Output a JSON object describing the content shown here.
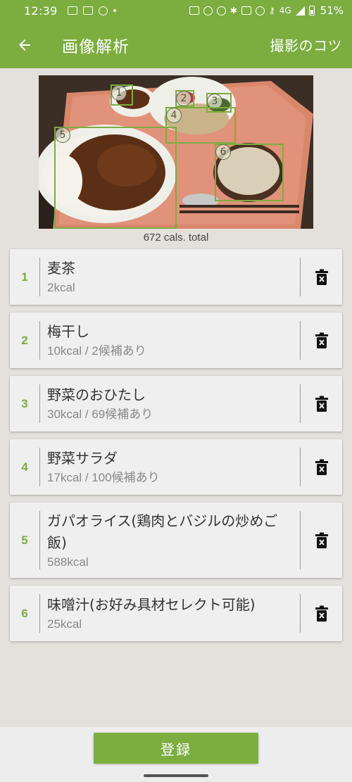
{
  "status_bar": {
    "time": "12:39",
    "network": "4G",
    "battery": "51%"
  },
  "app_bar": {
    "title": "画像解析",
    "tips_label": "撮影のコツ",
    "back_icon": "arrow-left-icon"
  },
  "photo": {
    "markers": [
      "1",
      "2",
      "3",
      "4",
      "5",
      "6"
    ]
  },
  "total": "672 cals. total",
  "foods": [
    {
      "index": "1",
      "name": "麦茶",
      "meta": "2kcal"
    },
    {
      "index": "2",
      "name": "梅干し",
      "meta": "10kcal / 2候補あり"
    },
    {
      "index": "3",
      "name": "野菜のおひたし",
      "meta": "30kcal / 69候補あり"
    },
    {
      "index": "4",
      "name": "野菜サラダ",
      "meta": "17kcal / 100候補あり"
    },
    {
      "index": "5",
      "name": "ガパオライス(鶏肉とバジルの炒めご飯)",
      "meta": "588kcal"
    },
    {
      "index": "6",
      "name": "味噌汁(お好み具材セレクト可能)",
      "meta": "25kcal"
    }
  ],
  "delete_icon": "trash-icon",
  "register_label": "登録",
  "colors": {
    "accent": "#7cad3f",
    "background": "#e4e0dc",
    "card": "#efefef"
  }
}
